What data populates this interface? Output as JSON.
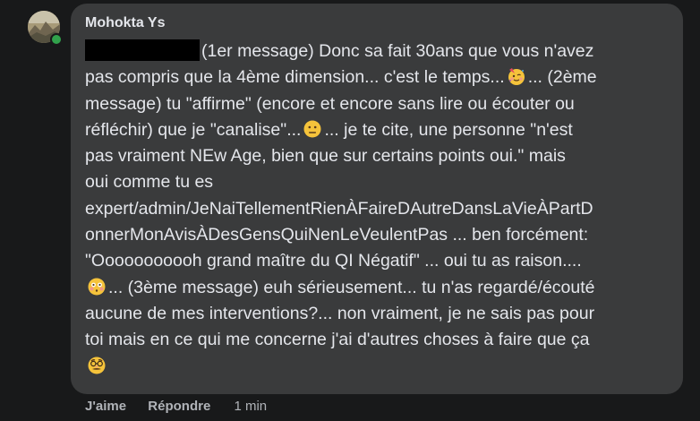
{
  "comment": {
    "author": "Mohokta Ys",
    "lines": [
      "(1er message) Donc sa fait 30ans que vous n'avez",
      "pas compris que la 4ème dimension... c'est le temps...",
      "... (2ème",
      "message) tu \"affirme\" (encore et encore sans lire ou écouter ou",
      "réfléchir) que je \"canalise\"...",
      "... je te cite, une personne \"n'est",
      "pas vraiment NEw Age, bien que sur certains points oui.\" mais",
      "oui comme tu es",
      "expert/admin/JeNaiTellementRienÀFaireDAutreDansLaVieÀPartD",
      "onnerMonAvisÀDesGensQuiNenLeVeulentPas ... ben forcément:",
      "\"Ooooooooooh grand maître du QI Négatif\" ... oui tu as raison....",
      "... (3ème message) euh sérieusement... tu n'as regardé/écouté",
      "aucune de mes interventions?... non vraiment, je ne sais pas pour",
      "toi mais en ce qui me concerne j'ai d'autres choses à faire que ça"
    ],
    "emojis": {
      "e1": "partying-face-icon",
      "e2": "neutral-face-icon",
      "e3": "flushed-face-icon",
      "e4": "disguised-face-icon"
    }
  },
  "actions": {
    "like": "J'aime",
    "reply": "Répondre",
    "time": "1 min"
  },
  "colors": {
    "background": "#18191a",
    "bubble": "#3a3b3c",
    "text": "#e4e6eb",
    "muted": "#b0b3b8",
    "online": "#31a24c"
  }
}
